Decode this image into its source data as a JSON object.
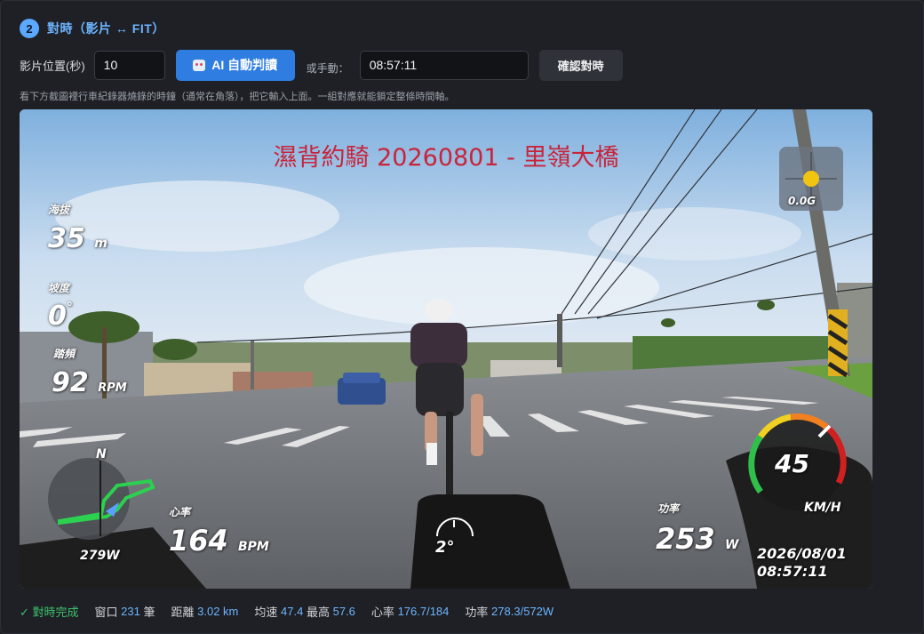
{
  "step": {
    "number": "2",
    "title": "對時（影片 ↔ FIT）"
  },
  "controls": {
    "position_label": "影片位置(秒)",
    "position_value": "10",
    "ai_button_label": "AI 自動判讀",
    "or_manual_label": "或手動：",
    "time_value": "08:57:11",
    "confirm_button_label": "確認對時"
  },
  "hint": "看下方截圖裡行車紀錄器燒錄的時鐘（通常在角落），把它輸入上面。一組對應就能鎖定整條時間軸。",
  "video": {
    "title_overlay": "濕背約騎 20260801 - 里嶺大橋",
    "gforce": "0.0G",
    "altitude_label": "海拔",
    "altitude_value": "35",
    "altitude_unit": "m",
    "grade_label": "坡度",
    "grade_value": "0",
    "grade_unit": "°",
    "cadence_label": "踏頻",
    "cadence_value": "92",
    "cadence_unit": "RPM",
    "compass_n": "N",
    "power_small": "279W",
    "hr_label": "心率",
    "hr_value": "164",
    "hr_unit": "BPM",
    "tilt": "2°",
    "power_label": "功率",
    "power_value": "253",
    "power_unit": "W",
    "speed_value": "45",
    "speed_unit": "KM/H",
    "date": "2026/08/01",
    "time": "08:57:11"
  },
  "status": {
    "done": "✓ 對時完成",
    "window_label": "窗口",
    "window_value": "231",
    "window_unit": "筆",
    "distance_label": "距離",
    "distance_value": "3.02 km",
    "avg_label": "均速",
    "avg_value": "47.4",
    "max_label": "最高",
    "max_value": "57.6",
    "hr_label": "心率",
    "hr_value": "176.7/184",
    "power_label": "功率",
    "power_value": "278.3/572W"
  },
  "colors": {
    "accent": "#2f7de1",
    "link_blue": "#6db4ff",
    "success": "#3ec26b",
    "title_red": "#c8243a"
  }
}
